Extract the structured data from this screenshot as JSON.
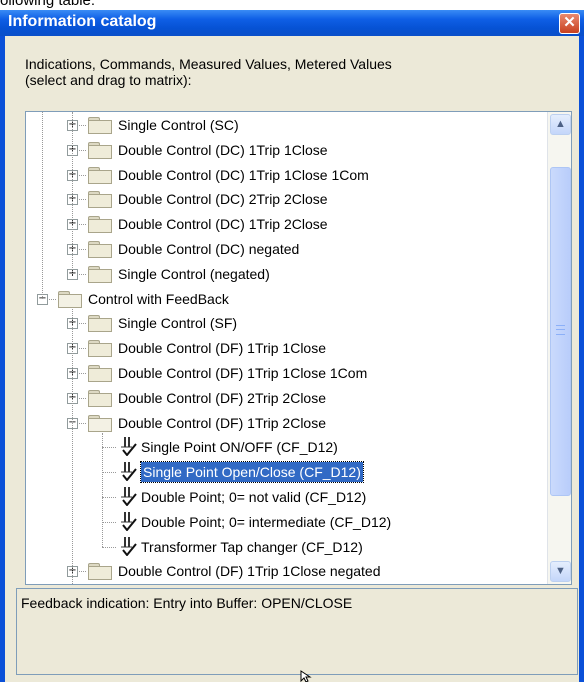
{
  "top_text": "ollowing table:",
  "window": {
    "title": "Information catalog",
    "close_glyph": "✕"
  },
  "description": {
    "line1": "Indications, Commands, Measured Values, Metered Values",
    "line2": "(select and drag to matrix):"
  },
  "tree": {
    "items": [
      {
        "label": "Single Control (SC)",
        "icon": "folder-icon",
        "expander": "+"
      },
      {
        "label": "Double Control (DC) 1Trip 1Close",
        "icon": "folder-icon",
        "expander": "+"
      },
      {
        "label": "Double Control (DC) 1Trip 1Close 1Com",
        "icon": "folder-icon",
        "expander": "+"
      },
      {
        "label": "Double Control (DC) 2Trip 2Close",
        "icon": "folder-icon",
        "expander": "+"
      },
      {
        "label": "Double Control (DC) 1Trip 2Close",
        "icon": "folder-icon",
        "expander": "+"
      },
      {
        "label": "Double Control (DC)  negated",
        "icon": "folder-icon",
        "expander": "+"
      },
      {
        "label": "Single Control (negated)",
        "icon": "folder-icon",
        "expander": "+"
      },
      {
        "label": "Control with FeedBack",
        "icon": "open-folder-icon",
        "expander": "−"
      },
      {
        "label": "Single Control (SF)",
        "icon": "folder-icon",
        "expander": "+"
      },
      {
        "label": "Double Control (DF) 1Trip 1Close",
        "icon": "folder-icon",
        "expander": "+"
      },
      {
        "label": "Double Control (DF) 1Trip 1Close 1Com",
        "icon": "folder-icon",
        "expander": "+"
      },
      {
        "label": "Double Control (DF) 2Trip 2Close",
        "icon": "folder-icon",
        "expander": "+"
      },
      {
        "label": "Double Control (DF) 1Trip 2Close",
        "icon": "open-folder-icon",
        "expander": "−"
      },
      {
        "label": "Single Point ON/OFF (CF_D12)",
        "icon": "indication-icon"
      },
      {
        "label": "Single Point Open/Close (CF_D12)",
        "icon": "indication-icon",
        "selected": true
      },
      {
        "label": "Double Point; 0= not valid (CF_D12)",
        "icon": "indication-icon"
      },
      {
        "label": "Double Point; 0= intermediate (CF_D12)",
        "icon": "indication-icon"
      },
      {
        "label": "Transformer Tap changer (CF_D12)",
        "icon": "indication-icon"
      },
      {
        "label": "Double Control (DF) 1Trip 1Close negated",
        "icon": "folder-icon",
        "expander": "+"
      }
    ]
  },
  "scrollbar": {
    "up_glyph": "▲",
    "down_glyph": "▼"
  },
  "status": {
    "text": "Feedback indication: Entry into Buffer: OPEN/CLOSE"
  },
  "colors": {
    "titlebar": "#0a50d8",
    "selection": "#316ac5",
    "dialog_bg": "#ece9d8"
  }
}
